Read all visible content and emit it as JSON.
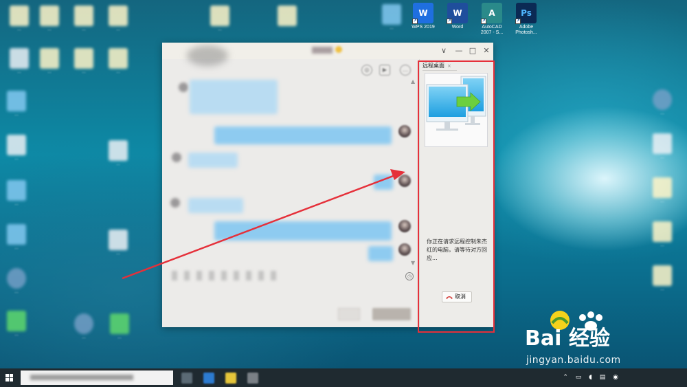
{
  "desktop": {
    "apps": [
      {
        "label_line1": "WPS 2019",
        "label_line2": "",
        "icon": "wps-icon",
        "color": "#1f6fe0",
        "glyph": "W"
      },
      {
        "label_line1": "Word",
        "label_line2": "",
        "icon": "word-icon",
        "color": "#1f4e9c",
        "glyph": "W"
      },
      {
        "label_line1": "AutoCAD",
        "label_line2": "2007 - S...",
        "icon": "autocad-icon",
        "color": "#2a8a8a",
        "glyph": "A"
      },
      {
        "label_line1": "Adobe",
        "label_line2": "Photosh...",
        "icon": "photoshop-icon",
        "color": "#0b2a54",
        "glyph": "Ps"
      }
    ]
  },
  "remote_desktop": {
    "tab_title": "远程桌面",
    "tab_close": "×",
    "message": "你正在请求远程控制朱杰红的电脑，请等待对方回应...",
    "cancel_label": "取消",
    "illustration": "remote-desktop-monitors-illustration"
  },
  "chat_window": {
    "minimize": "—",
    "maximize": "□",
    "close": "✕",
    "chevron": "∨"
  },
  "watermark": {
    "brand_text": "Bai 经验",
    "url": "jingyan.baidu.com"
  },
  "colors": {
    "highlight": "#e5303a",
    "arrow": "#e5303a",
    "bubble": "#8ecbf0"
  }
}
